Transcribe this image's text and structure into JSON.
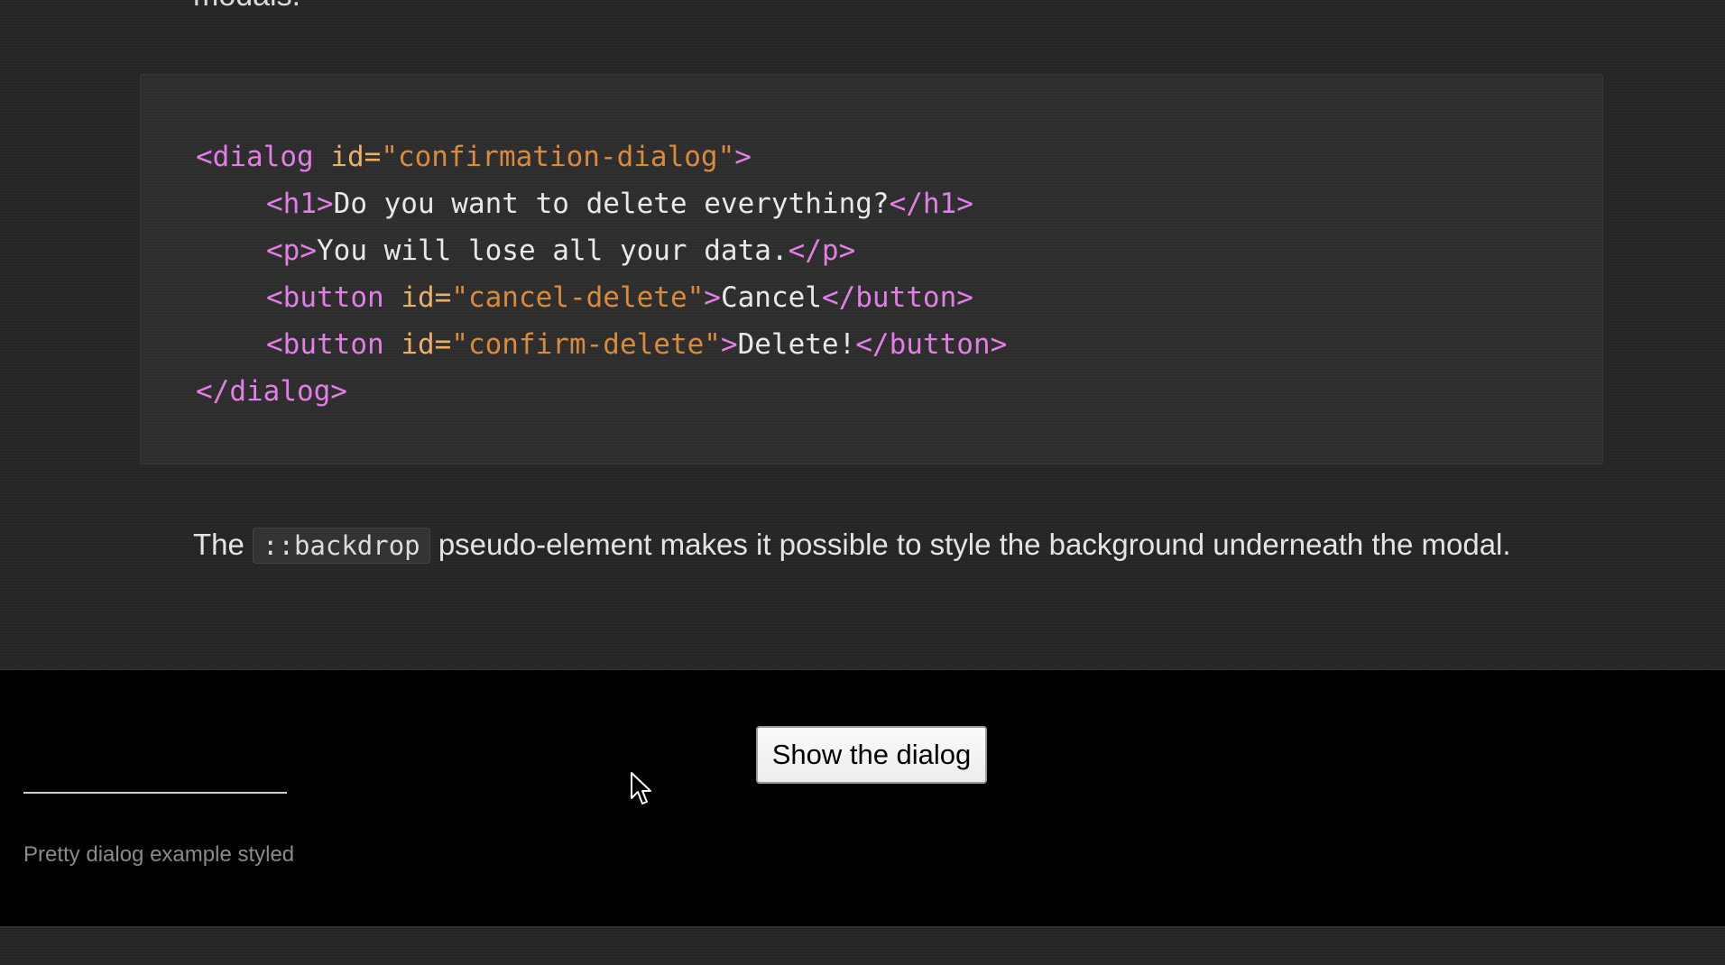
{
  "article": {
    "top_cut_text": "modals.",
    "code": {
      "line1": {
        "open": "<dialog ",
        "attr": "id=",
        "value": "\"confirmation-dialog\"",
        "close": ">"
      },
      "line2": {
        "open_tag": "<h1>",
        "text": "Do you want to delete everything?",
        "close_tag": "</h1>"
      },
      "line3": {
        "open_tag": "<p>",
        "text": "You will lose all your data.",
        "close_tag": "</p>"
      },
      "line4": {
        "open": "<button ",
        "attr": "id=",
        "value": "\"cancel-delete\"",
        "close": ">",
        "text": "Cancel",
        "close_tag": "</button>"
      },
      "line5": {
        "open": "<button ",
        "attr": "id=",
        "value": "\"confirm-delete\"",
        "close": ">",
        "text": "Delete!",
        "close_tag": "</button>"
      },
      "line6": {
        "close_tag": "</dialog>"
      }
    },
    "paragraph": {
      "before": "The ",
      "code": "::backdrop",
      "after": " pseudo-element makes it possible to style the background underneath the modal."
    }
  },
  "demo": {
    "button_label": "Show the dialog",
    "caption": "Pretty dialog example styled"
  },
  "colors": {
    "tag": "#e27ee5",
    "attribute": "#eab06a",
    "string": "#d98a3c",
    "demo_background": "#000000"
  },
  "icons": {
    "cursor": "mouse-pointer-icon"
  }
}
